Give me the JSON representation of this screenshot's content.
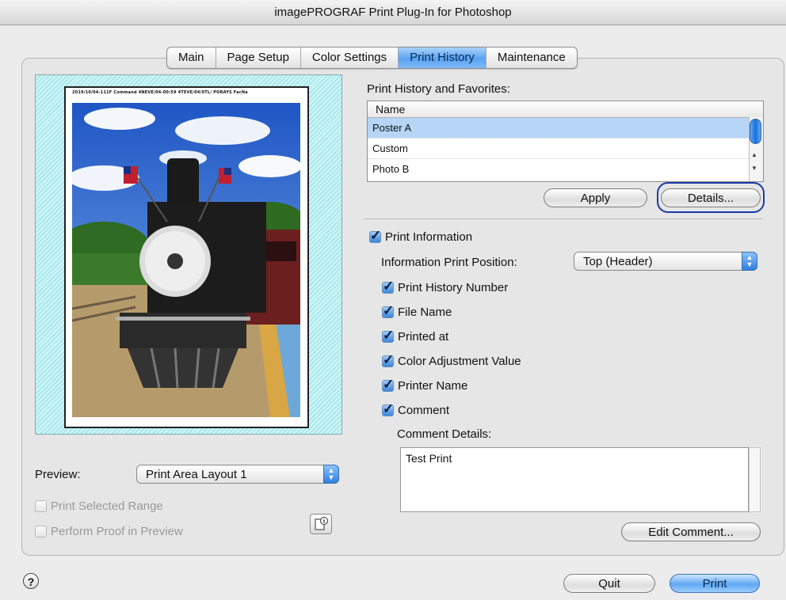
{
  "window": {
    "title": "imagePROGRAF Print Plug-In for Photoshop"
  },
  "tabs": [
    {
      "label": "Main"
    },
    {
      "label": "Page Setup"
    },
    {
      "label": "Color Settings"
    },
    {
      "label": "Print History",
      "active": true
    },
    {
      "label": "Maintenance"
    }
  ],
  "preview": {
    "header_text": "2019/10/04-111F Command 4NEVE/04-00:59 4TEVE/04/0TL/ PORAYS FacNa",
    "label": "Preview:",
    "selected": "Print Area Layout 1",
    "print_selected_range": "Print Selected Range",
    "perform_proof": "Perform Proof in Preview",
    "info_icon": "info-icon"
  },
  "history": {
    "title": "Print History and Favorites:",
    "column_name": "Name",
    "items": [
      "Poster A",
      "Custom",
      "Photo B"
    ],
    "selected_index": 0,
    "apply_label": "Apply",
    "details_label": "Details..."
  },
  "info": {
    "print_information": "Print Information",
    "position_label": "Information Print Position:",
    "position_value": "Top (Header)",
    "options": [
      "Print History Number",
      "File Name",
      "Printed at",
      "Color Adjustment Value",
      "Printer Name",
      "Comment"
    ],
    "comment_details_label": "Comment Details:",
    "comment_text": "Test Print",
    "edit_comment_label": "Edit Comment..."
  },
  "footer": {
    "help": "?",
    "quit_label": "Quit",
    "print_label": "Print"
  },
  "colors": {
    "accent": "#5aa3f0",
    "focus": "#1b3aa6",
    "selection": "#b6d5f7"
  }
}
